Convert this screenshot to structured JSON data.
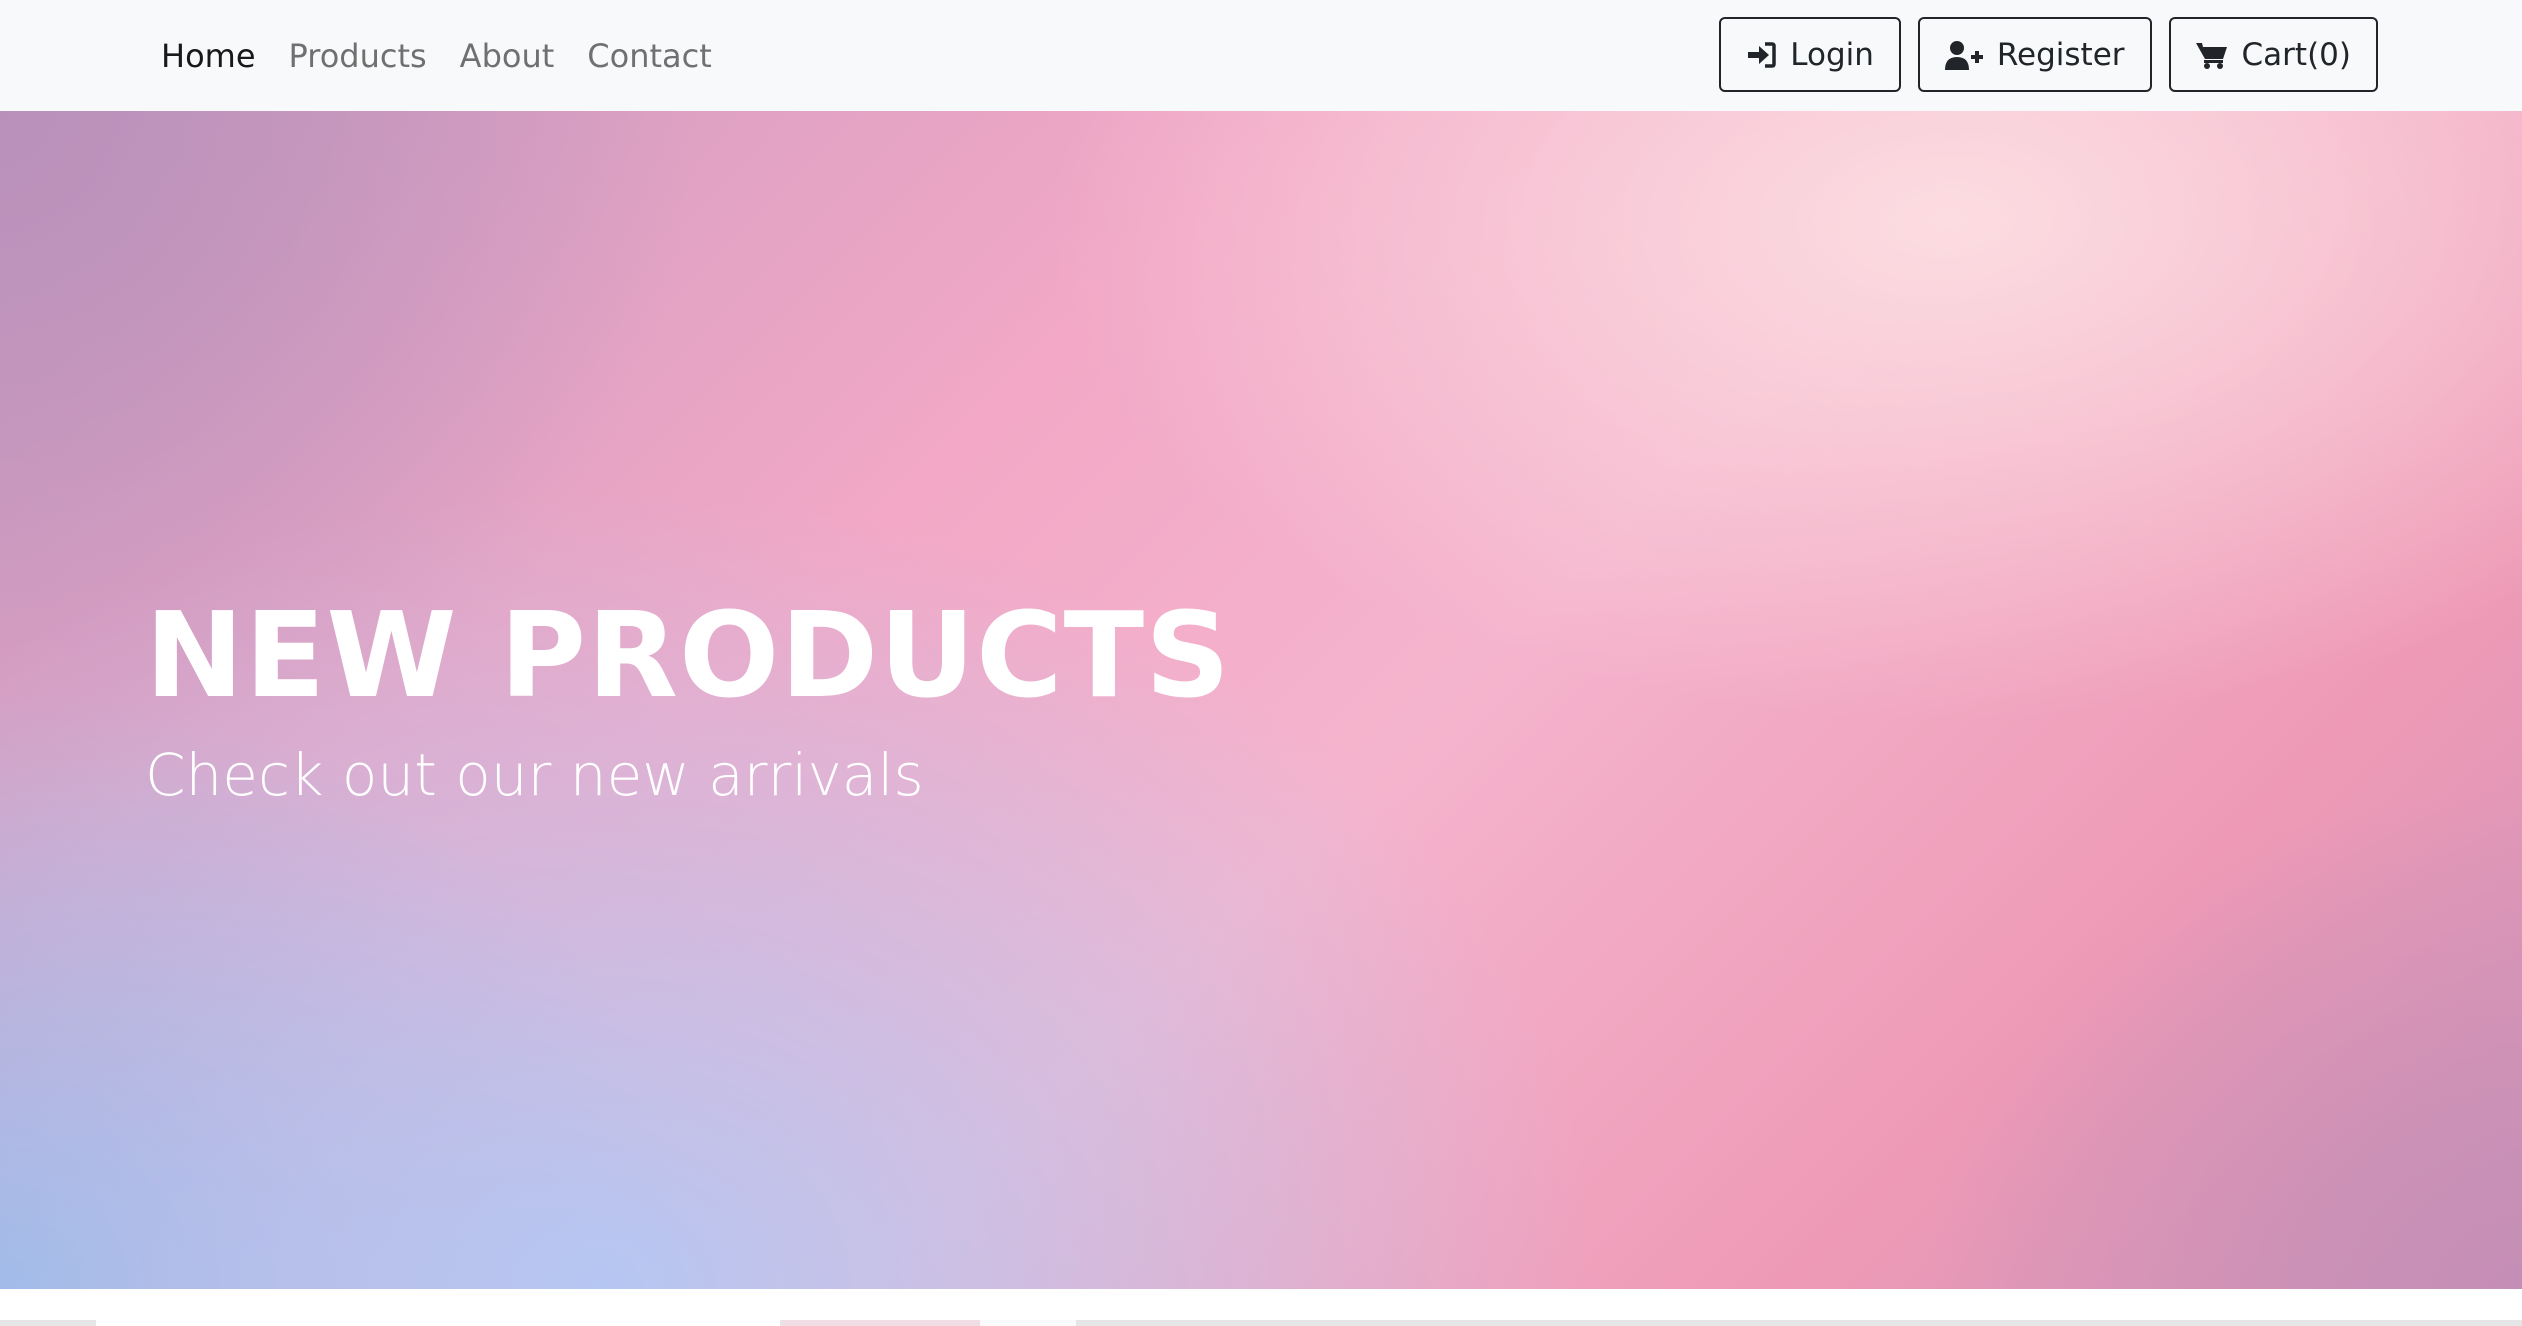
{
  "nav": {
    "links": [
      {
        "label": "Home",
        "active": true
      },
      {
        "label": "Products",
        "active": false
      },
      {
        "label": "About",
        "active": false
      },
      {
        "label": "Contact",
        "active": false
      }
    ],
    "login_label": "Login",
    "register_label": "Register",
    "cart_label": "Cart(0)",
    "icons": {
      "login": "sign-in-icon",
      "register": "user-plus-icon",
      "cart": "shopping-cart-icon"
    }
  },
  "hero": {
    "title": "NEW PRODUCTS",
    "subtitle": "Check out our new arrivals"
  },
  "colors": {
    "navbar_bg": "#f8f9fa",
    "text_dark": "#212529",
    "hero_text": "#ffffff"
  }
}
